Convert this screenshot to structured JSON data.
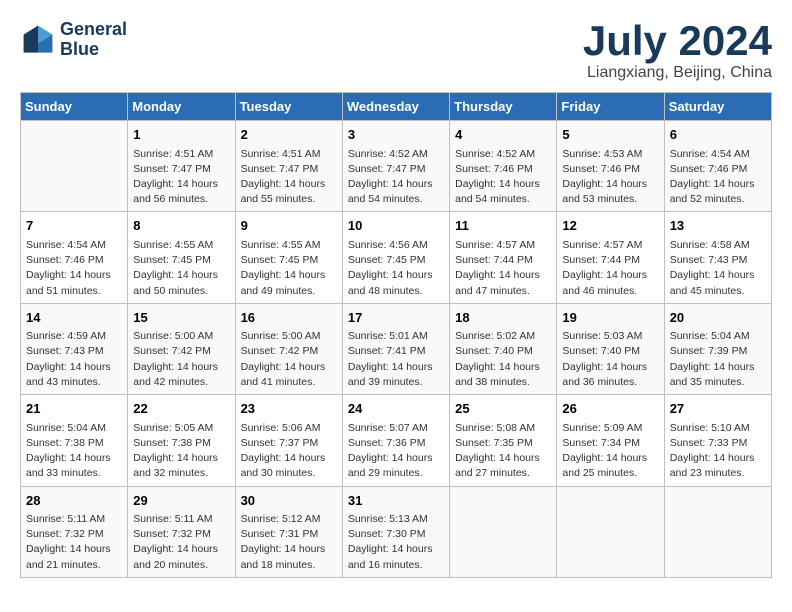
{
  "header": {
    "logo_line1": "General",
    "logo_line2": "Blue",
    "month": "July 2024",
    "location": "Liangxiang, Beijing, China"
  },
  "weekdays": [
    "Sunday",
    "Monday",
    "Tuesday",
    "Wednesday",
    "Thursday",
    "Friday",
    "Saturday"
  ],
  "weeks": [
    [
      {
        "day": "",
        "sunrise": "",
        "sunset": "",
        "daylight": ""
      },
      {
        "day": "1",
        "sunrise": "Sunrise: 4:51 AM",
        "sunset": "Sunset: 7:47 PM",
        "daylight": "Daylight: 14 hours and 56 minutes."
      },
      {
        "day": "2",
        "sunrise": "Sunrise: 4:51 AM",
        "sunset": "Sunset: 7:47 PM",
        "daylight": "Daylight: 14 hours and 55 minutes."
      },
      {
        "day": "3",
        "sunrise": "Sunrise: 4:52 AM",
        "sunset": "Sunset: 7:47 PM",
        "daylight": "Daylight: 14 hours and 54 minutes."
      },
      {
        "day": "4",
        "sunrise": "Sunrise: 4:52 AM",
        "sunset": "Sunset: 7:46 PM",
        "daylight": "Daylight: 14 hours and 54 minutes."
      },
      {
        "day": "5",
        "sunrise": "Sunrise: 4:53 AM",
        "sunset": "Sunset: 7:46 PM",
        "daylight": "Daylight: 14 hours and 53 minutes."
      },
      {
        "day": "6",
        "sunrise": "Sunrise: 4:54 AM",
        "sunset": "Sunset: 7:46 PM",
        "daylight": "Daylight: 14 hours and 52 minutes."
      }
    ],
    [
      {
        "day": "7",
        "sunrise": "Sunrise: 4:54 AM",
        "sunset": "Sunset: 7:46 PM",
        "daylight": "Daylight: 14 hours and 51 minutes."
      },
      {
        "day": "8",
        "sunrise": "Sunrise: 4:55 AM",
        "sunset": "Sunset: 7:45 PM",
        "daylight": "Daylight: 14 hours and 50 minutes."
      },
      {
        "day": "9",
        "sunrise": "Sunrise: 4:55 AM",
        "sunset": "Sunset: 7:45 PM",
        "daylight": "Daylight: 14 hours and 49 minutes."
      },
      {
        "day": "10",
        "sunrise": "Sunrise: 4:56 AM",
        "sunset": "Sunset: 7:45 PM",
        "daylight": "Daylight: 14 hours and 48 minutes."
      },
      {
        "day": "11",
        "sunrise": "Sunrise: 4:57 AM",
        "sunset": "Sunset: 7:44 PM",
        "daylight": "Daylight: 14 hours and 47 minutes."
      },
      {
        "day": "12",
        "sunrise": "Sunrise: 4:57 AM",
        "sunset": "Sunset: 7:44 PM",
        "daylight": "Daylight: 14 hours and 46 minutes."
      },
      {
        "day": "13",
        "sunrise": "Sunrise: 4:58 AM",
        "sunset": "Sunset: 7:43 PM",
        "daylight": "Daylight: 14 hours and 45 minutes."
      }
    ],
    [
      {
        "day": "14",
        "sunrise": "Sunrise: 4:59 AM",
        "sunset": "Sunset: 7:43 PM",
        "daylight": "Daylight: 14 hours and 43 minutes."
      },
      {
        "day": "15",
        "sunrise": "Sunrise: 5:00 AM",
        "sunset": "Sunset: 7:42 PM",
        "daylight": "Daylight: 14 hours and 42 minutes."
      },
      {
        "day": "16",
        "sunrise": "Sunrise: 5:00 AM",
        "sunset": "Sunset: 7:42 PM",
        "daylight": "Daylight: 14 hours and 41 minutes."
      },
      {
        "day": "17",
        "sunrise": "Sunrise: 5:01 AM",
        "sunset": "Sunset: 7:41 PM",
        "daylight": "Daylight: 14 hours and 39 minutes."
      },
      {
        "day": "18",
        "sunrise": "Sunrise: 5:02 AM",
        "sunset": "Sunset: 7:40 PM",
        "daylight": "Daylight: 14 hours and 38 minutes."
      },
      {
        "day": "19",
        "sunrise": "Sunrise: 5:03 AM",
        "sunset": "Sunset: 7:40 PM",
        "daylight": "Daylight: 14 hours and 36 minutes."
      },
      {
        "day": "20",
        "sunrise": "Sunrise: 5:04 AM",
        "sunset": "Sunset: 7:39 PM",
        "daylight": "Daylight: 14 hours and 35 minutes."
      }
    ],
    [
      {
        "day": "21",
        "sunrise": "Sunrise: 5:04 AM",
        "sunset": "Sunset: 7:38 PM",
        "daylight": "Daylight: 14 hours and 33 minutes."
      },
      {
        "day": "22",
        "sunrise": "Sunrise: 5:05 AM",
        "sunset": "Sunset: 7:38 PM",
        "daylight": "Daylight: 14 hours and 32 minutes."
      },
      {
        "day": "23",
        "sunrise": "Sunrise: 5:06 AM",
        "sunset": "Sunset: 7:37 PM",
        "daylight": "Daylight: 14 hours and 30 minutes."
      },
      {
        "day": "24",
        "sunrise": "Sunrise: 5:07 AM",
        "sunset": "Sunset: 7:36 PM",
        "daylight": "Daylight: 14 hours and 29 minutes."
      },
      {
        "day": "25",
        "sunrise": "Sunrise: 5:08 AM",
        "sunset": "Sunset: 7:35 PM",
        "daylight": "Daylight: 14 hours and 27 minutes."
      },
      {
        "day": "26",
        "sunrise": "Sunrise: 5:09 AM",
        "sunset": "Sunset: 7:34 PM",
        "daylight": "Daylight: 14 hours and 25 minutes."
      },
      {
        "day": "27",
        "sunrise": "Sunrise: 5:10 AM",
        "sunset": "Sunset: 7:33 PM",
        "daylight": "Daylight: 14 hours and 23 minutes."
      }
    ],
    [
      {
        "day": "28",
        "sunrise": "Sunrise: 5:11 AM",
        "sunset": "Sunset: 7:32 PM",
        "daylight": "Daylight: 14 hours and 21 minutes."
      },
      {
        "day": "29",
        "sunrise": "Sunrise: 5:11 AM",
        "sunset": "Sunset: 7:32 PM",
        "daylight": "Daylight: 14 hours and 20 minutes."
      },
      {
        "day": "30",
        "sunrise": "Sunrise: 5:12 AM",
        "sunset": "Sunset: 7:31 PM",
        "daylight": "Daylight: 14 hours and 18 minutes."
      },
      {
        "day": "31",
        "sunrise": "Sunrise: 5:13 AM",
        "sunset": "Sunset: 7:30 PM",
        "daylight": "Daylight: 14 hours and 16 minutes."
      },
      {
        "day": "",
        "sunrise": "",
        "sunset": "",
        "daylight": ""
      },
      {
        "day": "",
        "sunrise": "",
        "sunset": "",
        "daylight": ""
      },
      {
        "day": "",
        "sunrise": "",
        "sunset": "",
        "daylight": ""
      }
    ]
  ]
}
